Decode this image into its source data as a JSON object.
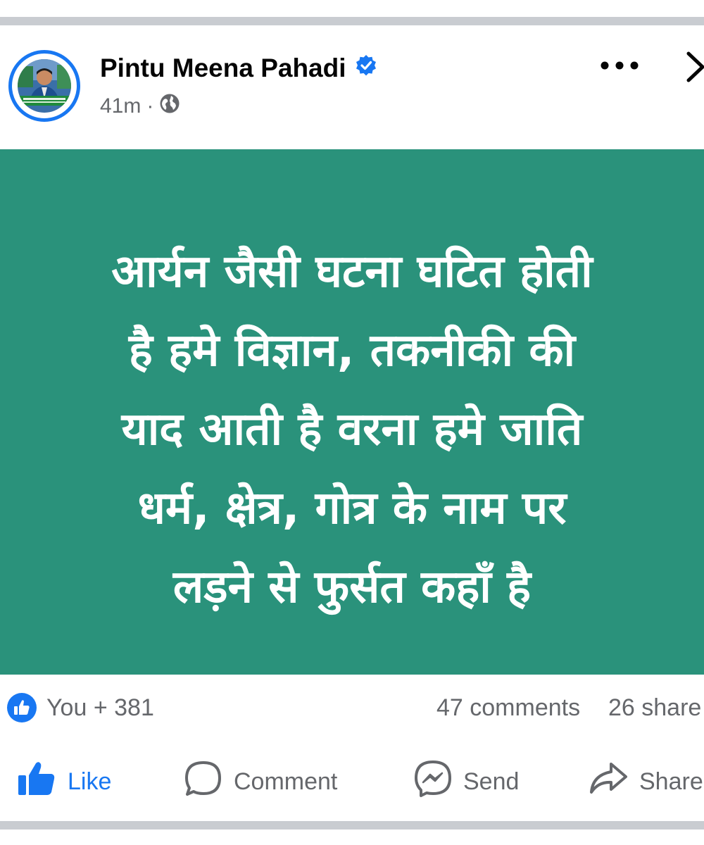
{
  "post": {
    "author": "Pintu Meena Pahadi",
    "time": "41m",
    "separator": "·",
    "lines": [
      "आर्यन जैसी घटना घटित होती",
      "है हमे विज्ञान, तकनीकी की",
      "याद आती है वरना हमे जाति",
      "धर्म, क्षेत्र, गोत्र के नाम पर",
      "लड़ने से फुर्सत कहाँ है"
    ],
    "background_color": "#2a927b"
  },
  "reactions": {
    "summary": "You + 381",
    "comments": "47 comments",
    "shares": "26 share"
  },
  "actions": {
    "like": "Like",
    "comment": "Comment",
    "send": "Send",
    "share": "Share"
  },
  "colors": {
    "accent": "#1877f2",
    "muted": "#65676b"
  },
  "icons": [
    "verified-badge-icon",
    "globe-icon",
    "more-options-icon",
    "chevron-right-icon",
    "thumbs-up-icon",
    "comment-bubble-icon",
    "messenger-icon",
    "share-arrow-icon"
  ]
}
